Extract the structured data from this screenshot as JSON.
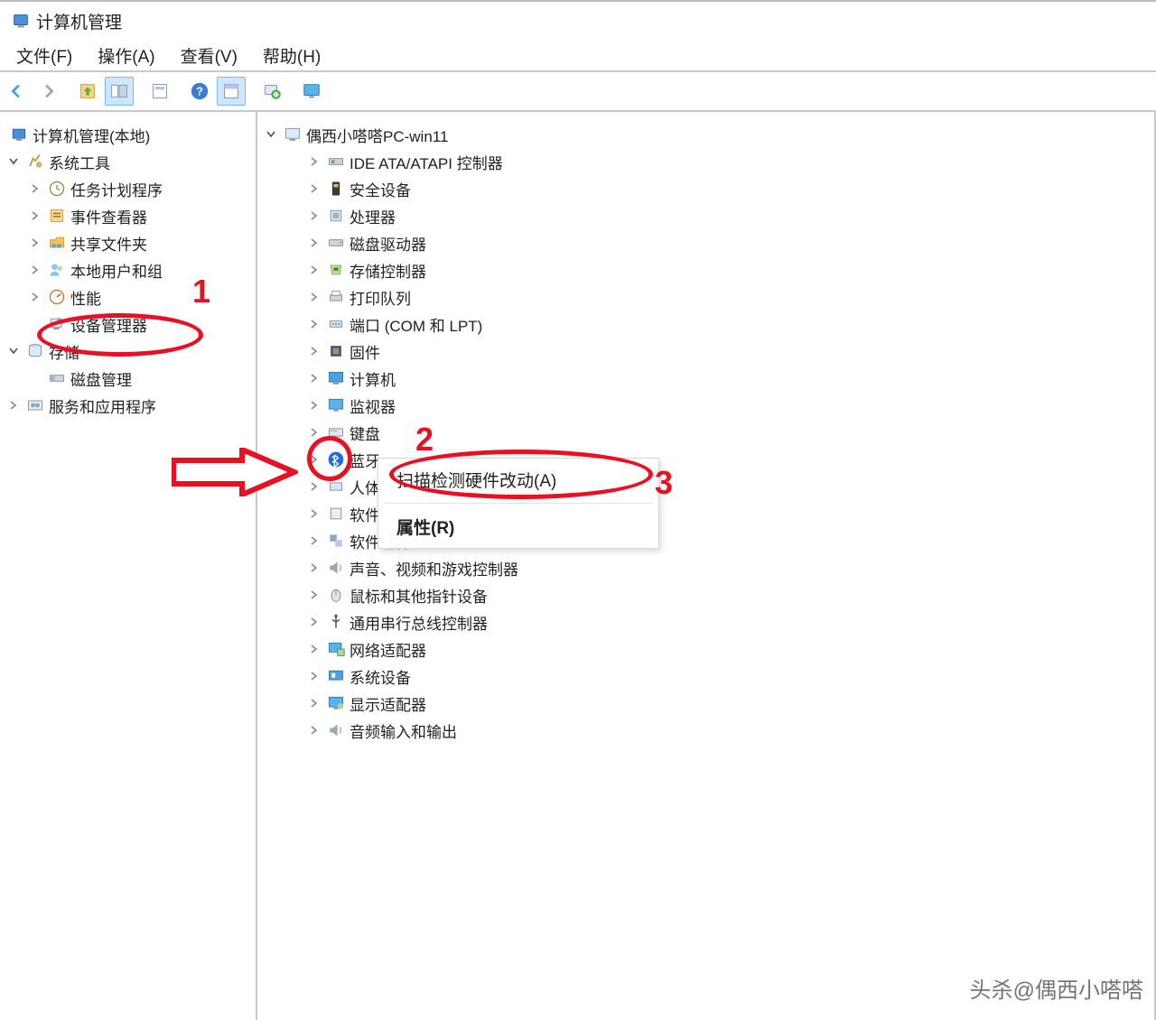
{
  "app_title": "计算机管理",
  "menu": {
    "file": "文件(F)",
    "action": "操作(A)",
    "view": "查看(V)",
    "help": "帮助(H)"
  },
  "left_root": "计算机管理(本地)",
  "left_systools": "系统工具",
  "left_items": {
    "task": "任务计划程序",
    "event": "事件查看器",
    "shared": "共享文件夹",
    "users": "本地用户和组",
    "perf": "性能",
    "devmgr": "设备管理器"
  },
  "left_storage": "存储",
  "left_disk": "磁盘管理",
  "left_services": "服务和应用程序",
  "right_root": "偶西小嗒嗒PC-win11",
  "dev": {
    "ide": "IDE ATA/ATAPI 控制器",
    "security": "安全设备",
    "cpu": "处理器",
    "diskdrv": "磁盘驱动器",
    "storctrl": "存储控制器",
    "printq": "打印队列",
    "ports": "端口 (COM 和 LPT)",
    "firmware": "固件",
    "computer": "计算机",
    "monitor": "监视器",
    "keyboard": "键盘",
    "bt": "蓝牙",
    "hid_a": "人体",
    "sw_a": "软件",
    "swcomp": "软件组件",
    "audio": "声音、视频和游戏控制器",
    "mouse": "鼠标和其他指针设备",
    "usb": "通用串行总线控制器",
    "net": "网络适配器",
    "sysdev": "系统设备",
    "display": "显示适配器",
    "audioio": "音频输入和输出"
  },
  "ctx": {
    "scan": "扫描检测硬件改动(A)",
    "prop": "属性(R)"
  },
  "anno": {
    "n1": "1",
    "n2": "2",
    "n3": "3"
  },
  "watermark": "头杀@偶西小嗒嗒"
}
